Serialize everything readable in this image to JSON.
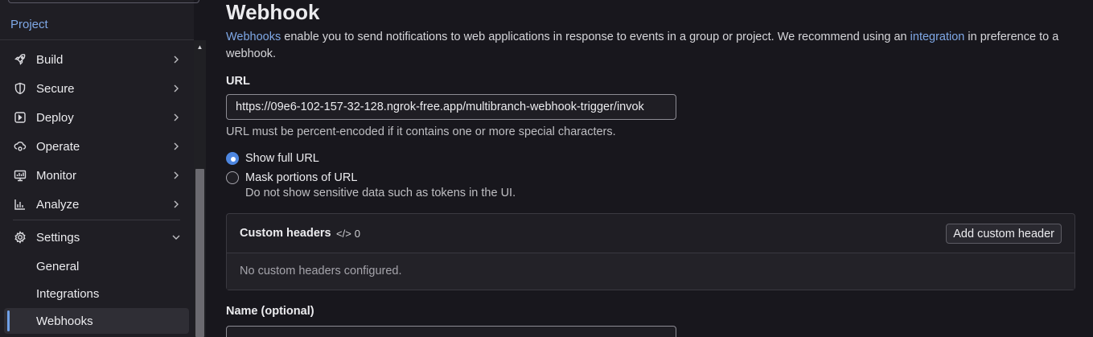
{
  "sidebar": {
    "section_title": "Project",
    "nav": [
      {
        "label": "Build",
        "icon": "rocket-icon"
      },
      {
        "label": "Secure",
        "icon": "shield-icon"
      },
      {
        "label": "Deploy",
        "icon": "deploy-icon"
      },
      {
        "label": "Operate",
        "icon": "cloud-gear-icon"
      },
      {
        "label": "Monitor",
        "icon": "monitor-icon"
      },
      {
        "label": "Analyze",
        "icon": "chart-icon"
      },
      {
        "label": "Settings",
        "icon": "gear-icon"
      }
    ],
    "settings_sub": [
      {
        "label": "General"
      },
      {
        "label": "Integrations"
      },
      {
        "label": "Webhooks",
        "active": true
      }
    ]
  },
  "main": {
    "title": "Webhook",
    "intro": {
      "link1": "Webhooks",
      "text1": " enable you to send notifications to web applications in response to events in a group or project. We recommend using an ",
      "link2": "integration",
      "text2": " in preference to a webhook."
    },
    "url": {
      "label": "URL",
      "value": "https://09e6-102-157-32-128.ngrok-free.app/multibranch-webhook-trigger/invok",
      "help": "URL must be percent-encoded if it contains one or more special characters."
    },
    "url_display": {
      "option_full": "Show full URL",
      "option_mask": "Mask portions of URL",
      "mask_help": "Do not show sensitive data such as tokens in the UI.",
      "selected": "Show full URL"
    },
    "custom_headers": {
      "title": "Custom headers",
      "count": "0",
      "add_button": "Add custom header",
      "empty": "No custom headers configured."
    },
    "name": {
      "label": "Name (optional)",
      "value": ""
    }
  },
  "colors": {
    "accent": "#4d86e0",
    "link": "#7fa8e6",
    "background": "#18171d",
    "sidebar": "#1f1e24"
  }
}
